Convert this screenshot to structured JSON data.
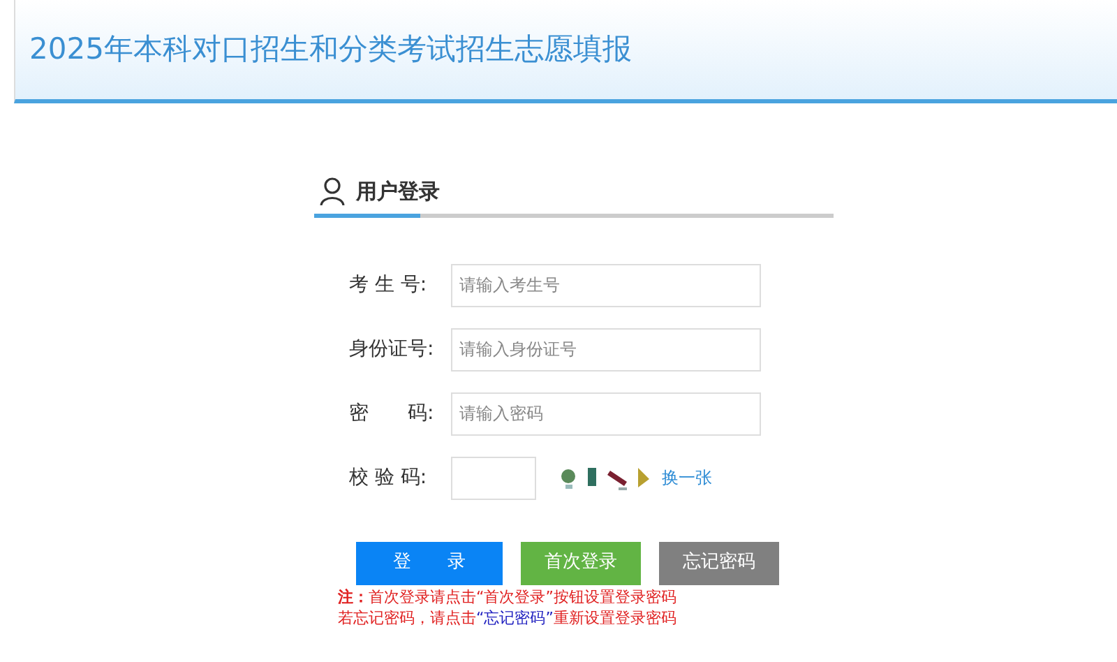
{
  "header": {
    "title": "2025年本科对口招生和分类考试招生志愿填报"
  },
  "login": {
    "heading": "用户登录",
    "fields": [
      {
        "label": "考 生 号:",
        "placeholder": "请输入考生号",
        "kind": "wide"
      },
      {
        "label": "身份证号:",
        "placeholder": "请输入身份证号",
        "kind": "wide"
      },
      {
        "label": "密　　码:",
        "placeholder": "请输入密码",
        "kind": "wide"
      },
      {
        "label": "校 验 码:",
        "kind": "captcha",
        "refresh": "换一张"
      }
    ],
    "buttons": [
      {
        "label": "登　　录",
        "kind": "primary"
      },
      {
        "label": "首次登录",
        "kind": "success"
      },
      {
        "label": "忘记密码",
        "kind": "neutral"
      }
    ],
    "notes": [
      [
        {
          "text": "**注：**首次登录请点击“首次登录”按钮设置登录密码",
          "kind": "plain"
        }
      ],
      [
        {
          "text": "若忘记密码，请点击",
          "kind": "plain"
        },
        {
          "text": "“忘记密码”",
          "kind": "highlight"
        },
        {
          "text": "重新设置登录密码",
          "kind": "plain"
        }
      ]
    ]
  }
}
